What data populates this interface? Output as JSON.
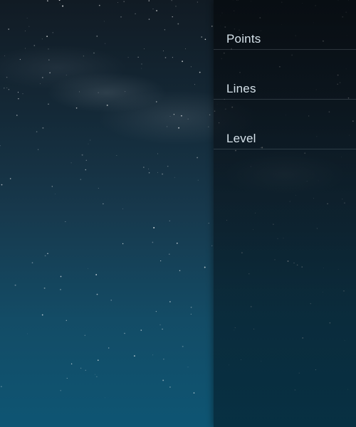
{
  "panel": {
    "stats": [
      {
        "label": "Points",
        "value": ""
      },
      {
        "label": "Lines",
        "value": ""
      },
      {
        "label": "Level",
        "value": ""
      }
    ]
  },
  "colors": {
    "sky_top": "#111b24",
    "sky_bottom": "#0e5573",
    "panel_text": "#d6e2ea"
  }
}
